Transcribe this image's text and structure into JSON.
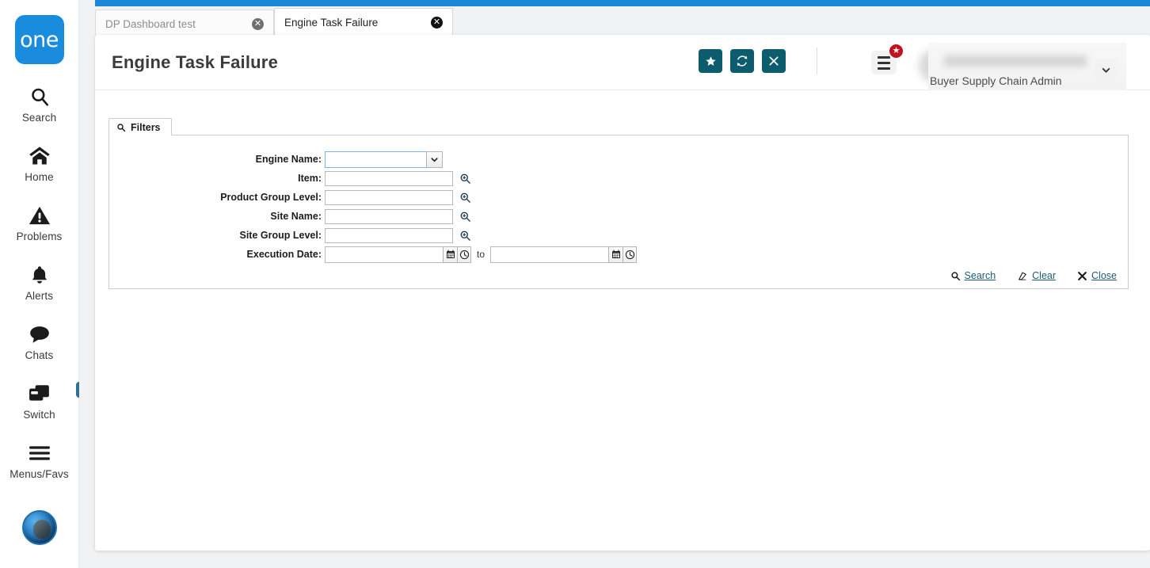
{
  "rail": {
    "logo_text": "one",
    "items": [
      {
        "label": "Search",
        "icon": "search-icon"
      },
      {
        "label": "Home",
        "icon": "home-icon"
      },
      {
        "label": "Problems",
        "icon": "warning-triangle-icon"
      },
      {
        "label": "Alerts",
        "icon": "bell-icon"
      },
      {
        "label": "Chats",
        "icon": "chat-bubble-icon"
      },
      {
        "label": "Switch",
        "icon": "windows-stack-icon",
        "badge_icon": "swap-arrows-icon"
      },
      {
        "label": "Menus/Favs",
        "icon": "hamburger-icon"
      }
    ],
    "assistant_avatar": "ai-assistant-avatar"
  },
  "tabs": [
    {
      "label": "DP Dashboard test",
      "active": false,
      "close_icon": "close-circle-icon"
    },
    {
      "label": "Engine Task Failure",
      "active": true,
      "close_icon": "close-circle-icon"
    }
  ],
  "header": {
    "title": "Engine Task Failure",
    "actions": [
      {
        "name": "favorite-button",
        "icon": "star-icon",
        "glyph": "★"
      },
      {
        "name": "refresh-button",
        "icon": "refresh-icon",
        "glyph": "↻"
      },
      {
        "name": "close-button",
        "icon": "close-x-icon",
        "glyph": "✕"
      }
    ],
    "menu_badge_glyph": "★",
    "user_role": "Buyer Supply Chain Admin",
    "user_chevron_glyph": "❯",
    "accent_color": "#0d5c6e",
    "badge_color": "#c1121f"
  },
  "filters": {
    "tab_label": "Filters",
    "tab_icon": "search-icon",
    "fields": [
      {
        "label": "Engine Name:",
        "type": "select",
        "value": "",
        "name": "engine-name-select",
        "focused": true
      },
      {
        "label": "Item:",
        "type": "lookup",
        "value": "",
        "name": "item-input",
        "lookup_icon": "magnifier-plus-icon"
      },
      {
        "label": "Product Group Level:",
        "type": "lookup",
        "value": "",
        "name": "product-group-level-input",
        "lookup_icon": "magnifier-plus-icon"
      },
      {
        "label": "Site Name:",
        "type": "lookup",
        "value": "",
        "name": "site-name-input",
        "lookup_icon": "magnifier-plus-icon"
      },
      {
        "label": "Site Group Level:",
        "type": "lookup",
        "value": "",
        "name": "site-group-level-input",
        "lookup_icon": "magnifier-plus-icon"
      },
      {
        "label": "Execution Date:",
        "type": "daterange",
        "value_from": "",
        "value_to": "",
        "separator": "to",
        "name": "execution-date-range",
        "calendar_icon": "calendar-icon",
        "clock_icon": "clock-icon"
      }
    ],
    "actions": [
      {
        "label": "Search",
        "icon": "search-icon",
        "name": "filter-search-link"
      },
      {
        "label": "Clear",
        "icon": "eraser-icon",
        "name": "filter-clear-link"
      },
      {
        "label": "Close",
        "icon": "close-x-icon",
        "name": "filter-close-link"
      }
    ],
    "link_color": "#1b5c73"
  }
}
